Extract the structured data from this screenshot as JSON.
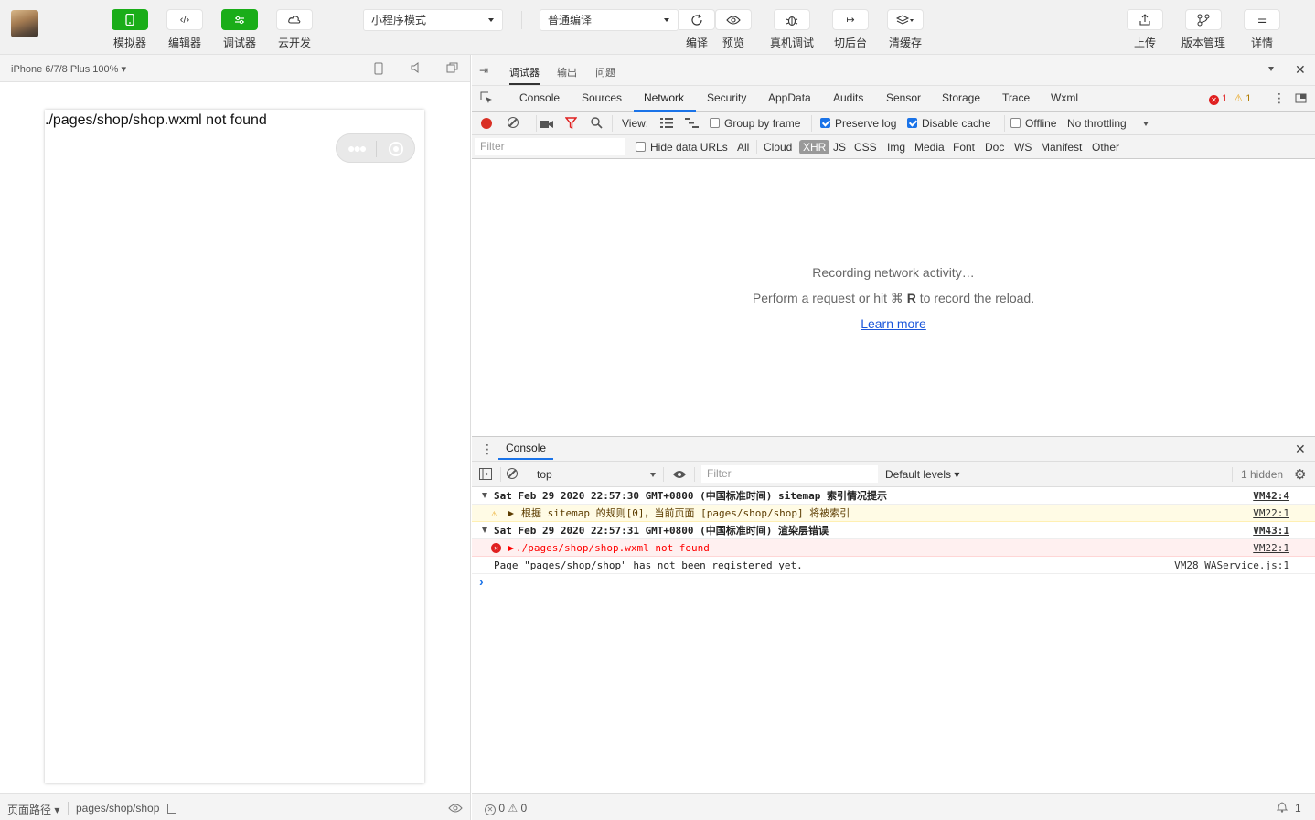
{
  "toolbar": {
    "left_buttons": [
      {
        "label": "模拟器",
        "icon": "phone-icon"
      },
      {
        "label": "编辑器",
        "icon": "code-icon"
      },
      {
        "label": "调试器",
        "icon": "debug-icon"
      },
      {
        "label": "云开发",
        "icon": "cloud-icon"
      }
    ],
    "mode_select": "小程序模式",
    "compile_select": "普通编译",
    "compile_label": "编译",
    "preview_label": "预览",
    "real_debug_label": "真机调试",
    "switch_backend_label": "切后台",
    "clear_cache_label": "清缓存",
    "upload_label": "上传",
    "version_label": "版本管理",
    "details_label": "详情",
    "active_color": "#1aad19"
  },
  "simulator": {
    "device": "iPhone 6/7/8 Plus 100%",
    "error_text": "./pages/shop/shop.wxml not found",
    "footer_path_label": "页面路径",
    "footer_path_value": "pages/shop/shop"
  },
  "devtools": {
    "top_tabs": [
      "调试器",
      "输出",
      "问题"
    ],
    "panel_tabs": [
      "Console",
      "Sources",
      "Network",
      "Security",
      "AppData",
      "Audits",
      "Sensor",
      "Storage",
      "Trace",
      "Wxml"
    ],
    "active_panel": "Network",
    "error_count": "1",
    "warning_count": "1",
    "network": {
      "view_label": "View:",
      "group_by_frame": "Group by frame",
      "preserve_log": "Preserve log",
      "disable_cache": "Disable cache",
      "offline": "Offline",
      "throttling": "No throttling",
      "filter_placeholder": "Filter",
      "hide_data_urls": "Hide data URLs",
      "type_filters": [
        "All",
        "Cloud",
        "XHR",
        "JS",
        "CSS",
        "Img",
        "Media",
        "Font",
        "Doc",
        "WS",
        "Manifest",
        "Other"
      ],
      "active_type": "XHR",
      "empty_line1": "Recording network activity…",
      "empty_line2_pre": "Perform a request or hit ⌘",
      "empty_line2_key": "R",
      "empty_line2_post": "to record the reload.",
      "learn_more": "Learn more"
    },
    "console": {
      "tab": "Console",
      "context": "top",
      "filter_placeholder": "Filter",
      "levels": "Default levels",
      "hidden": "1 hidden",
      "logs": [
        {
          "type": "group",
          "text": "Sat Feb 29 2020 22:57:30 GMT+0800 (中国标准时间) sitemap 索引情况提示",
          "source": "VM42:4"
        },
        {
          "type": "warn",
          "text": "根据 sitemap 的规则[0]，当前页面 [pages/shop/shop] 将被索引",
          "source": "VM22:1"
        },
        {
          "type": "group",
          "text": "Sat Feb 29 2020 22:57:31 GMT+0800 (中国标准时间) 渲染层错误",
          "source": "VM43:1"
        },
        {
          "type": "err",
          "text": "./pages/shop/shop.wxml not found",
          "source": "VM22:1"
        },
        {
          "type": "info",
          "text": "Page \"pages/shop/shop\" has not been registered yet.",
          "source": "VM28 WAService.js:1"
        }
      ],
      "prompt": "›"
    },
    "status": {
      "errors": "0",
      "warnings": "0",
      "notifications": "1"
    }
  }
}
